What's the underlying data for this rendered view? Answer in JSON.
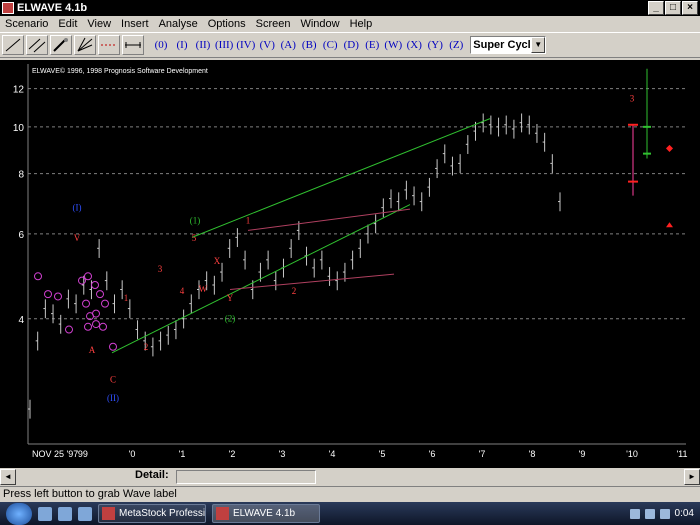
{
  "window": {
    "title": "ELWAVE 4.1b"
  },
  "menu": [
    "Scenario",
    "Edit",
    "View",
    "Insert",
    "Analyse",
    "Options",
    "Screen",
    "Window",
    "Help"
  ],
  "toolbar": {
    "tools": [
      "line-tool",
      "parallel-lines-tool",
      "pen-tool",
      "fan-tool",
      "dashed-line-tool",
      "measure-tool"
    ],
    "wave_buttons": [
      "(0)",
      "(I)",
      "(II)",
      "(III)",
      "(IV)",
      "(V)",
      "(A)",
      "(B)",
      "(C)",
      "(D)",
      "(E)",
      "(W)",
      "(X)",
      "(Y)",
      "(Z)"
    ],
    "degree": "Super Cycle"
  },
  "chart_data": {
    "type": "bar",
    "title": "",
    "copyright": "ELWAVE© 1996, 1998 Prognosis Software Development",
    "x_tick_labels": [
      "NOV 25 '97",
      "'99",
      "'0",
      "'1",
      "'2",
      "'3",
      "'4",
      "'5",
      "'6",
      "'7",
      "'8",
      "'9",
      "'10",
      "'11"
    ],
    "y_tick_labels": [
      "12",
      "10",
      "8",
      "6",
      "4"
    ],
    "y_scale": "log",
    "ylim": [
      2.2,
      13.5
    ],
    "grid": "dashed horizontal",
    "series": [
      {
        "values": [
          2.6,
          3.6,
          4.2,
          4.1,
          3.9,
          4.4,
          4.3,
          4.7,
          4.6,
          5.6,
          4.8,
          4.3,
          4.6,
          4.2,
          3.8,
          3.6,
          3.5,
          3.6,
          3.7,
          3.8,
          4.0,
          4.3,
          4.6,
          4.8,
          4.7,
          5.0,
          5.6,
          5.9,
          5.3,
          4.6,
          5.0,
          5.3,
          4.8,
          5.1,
          5.6,
          6.1,
          5.4,
          5.1,
          5.3,
          4.9,
          4.8,
          5.0,
          5.3,
          5.6,
          6.0,
          6.3,
          6.8,
          7.1,
          7.0,
          7.4,
          7.2,
          7.0,
          7.5,
          8.2,
          8.8,
          8.3,
          8.4,
          9.2,
          9.8,
          10.2,
          10.1,
          10.0,
          10.1,
          9.9,
          10.2,
          10.1,
          9.7,
          9.3,
          8.4,
          7.0
        ]
      }
    ],
    "wave_labels": [
      {
        "text": "(I)",
        "color": "#3050ff"
      },
      {
        "text": "(II)",
        "color": "#3050ff"
      },
      {
        "text": "V",
        "color": "#ff4040"
      },
      {
        "text": "A",
        "color": "#ff4040"
      },
      {
        "text": "C",
        "color": "#ff4040"
      },
      {
        "text": "1",
        "color": "#ff4040"
      },
      {
        "text": "2",
        "color": "#ff4040"
      },
      {
        "text": "3",
        "color": "#ff4040"
      },
      {
        "text": "4",
        "color": "#ff4040"
      },
      {
        "text": "5",
        "color": "#ff4040"
      },
      {
        "text": "(1)",
        "color": "#30c030"
      },
      {
        "text": "(2)",
        "color": "#30c030"
      },
      {
        "text": "W",
        "color": "#ff4040"
      },
      {
        "text": "X",
        "color": "#ff4040"
      },
      {
        "text": "Y",
        "color": "#ff4040"
      },
      {
        "text": "1",
        "color": "#ff4040"
      },
      {
        "text": "2",
        "color": "#ff4040"
      },
      {
        "text": "3",
        "color": "#ff4040"
      }
    ],
    "colors": {
      "background": "#000000",
      "bars": "#c8c8c8",
      "grid": "#808080",
      "channel": "#30c030",
      "triangle": "#b04060"
    }
  },
  "scroll": {
    "detail_label": "Detail:"
  },
  "status": {
    "text": "Press left button to grab Wave label"
  },
  "taskbar": {
    "tasks": [
      {
        "label": "MetaStock Profession...",
        "active": false
      },
      {
        "label": "ELWAVE 4.1b",
        "active": true
      }
    ],
    "clock": "0:04"
  }
}
